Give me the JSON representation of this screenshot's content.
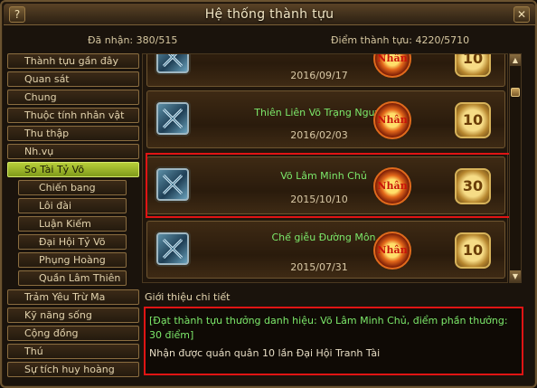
{
  "window": {
    "title": "Hệ thống thành tựu",
    "help_label": "?",
    "close_label": "✕"
  },
  "stats": {
    "received": "Đã nhận: 380/515",
    "points": "Điểm thành tựu: 4220/5710"
  },
  "sidebar": {
    "items": [
      {
        "label": "Thành tựu gần đây"
      },
      {
        "label": "Quan sát"
      },
      {
        "label": "Chung"
      },
      {
        "label": "Thuộc tính nhân vật"
      },
      {
        "label": "Thu thập"
      },
      {
        "label": "Nh.vụ"
      },
      {
        "label": "So Tài Tỷ Võ"
      },
      {
        "label": "Chiến bang"
      },
      {
        "label": "Lôi đài"
      },
      {
        "label": "Luận Kiếm"
      },
      {
        "label": "Đại Hội Tỷ Võ"
      },
      {
        "label": "Phụng Hoàng"
      },
      {
        "label": "Quần Lâm Thiên"
      },
      {
        "label": "Trảm Yêu Trừ Ma"
      },
      {
        "label": "Kỹ năng sống"
      },
      {
        "label": "Cộng đồng"
      },
      {
        "label": "Thú"
      },
      {
        "label": "Sự tích huy hoàng"
      }
    ]
  },
  "achievements": [
    {
      "name": "",
      "date": "2016/09/17",
      "points": "10",
      "badge": "Nhân"
    },
    {
      "name": "Thiên Liên Võ Trạng Nguyên",
      "date": "2016/02/03",
      "points": "10",
      "badge": "Nhân"
    },
    {
      "name": "Võ Lâm Minh Chủ",
      "date": "2015/10/10",
      "points": "30",
      "badge": "Nhân"
    },
    {
      "name": "Chế giễu Đường Môn",
      "date": "2015/07/31",
      "points": "10",
      "badge": "Nhân"
    }
  ],
  "detail": {
    "heading": "Giới thiệu chi tiết",
    "reward_text": "[Đạt thành tựu thưởng danh hiệu: Võ Lâm Minh Chủ, điểm phần thưởng: 30 điểm]",
    "description": "Nhận được quán quân 10 lần Đại Hội Tranh Tài"
  },
  "scroll": {
    "up": "▲",
    "down": "▼"
  },
  "colors": {
    "accent_green": "#7ce86a",
    "active_tab": "#b8cf3a",
    "selection_red": "#e01414"
  }
}
